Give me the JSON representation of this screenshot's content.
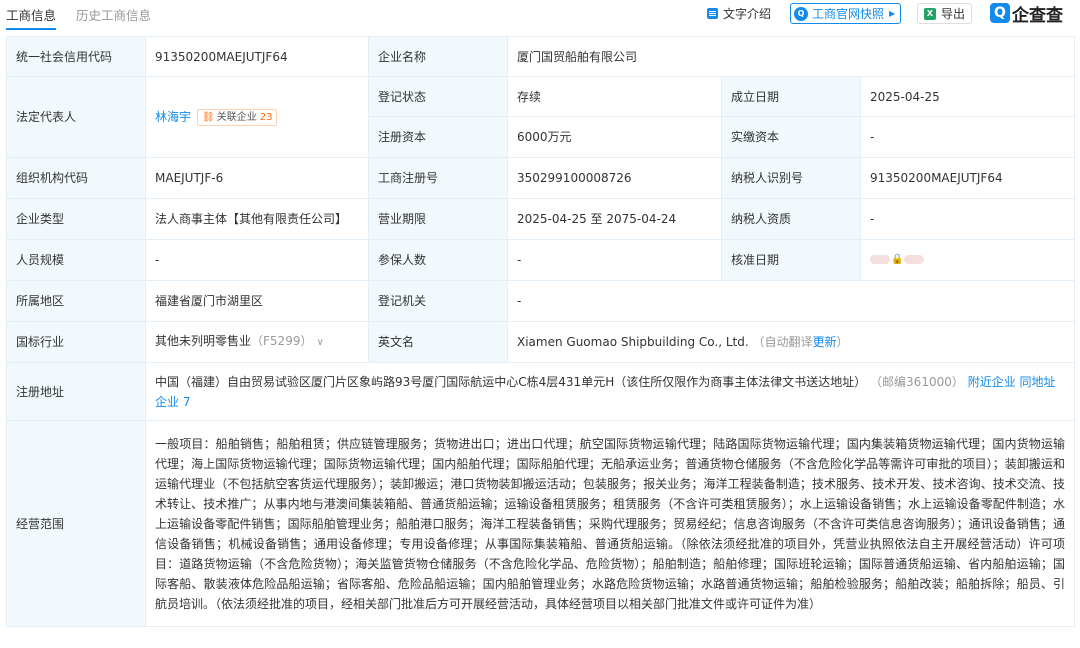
{
  "tabs": [
    {
      "label": "工商信息",
      "active": true
    },
    {
      "label": "历史工商信息",
      "active": false
    }
  ],
  "toolbar": {
    "intro_label": "文字介绍",
    "snapshot_label": "工商官网快照",
    "export_label": "导出",
    "brand_label": "企查查",
    "brand_mark": "Q",
    "excel_mark": "X"
  },
  "colors": {
    "accent": "#128bed",
    "label_bg": "#f2f9fc",
    "border": "#e4eef6",
    "related": "#ff6a00"
  },
  "labels": {
    "credit_code": "统一社会信用代码",
    "company_name": "企业名称",
    "legal_rep": "法定代表人",
    "reg_status": "登记状态",
    "est_date": "成立日期",
    "reg_capital": "注册资本",
    "paid_capital": "实缴资本",
    "org_code": "组织机构代码",
    "biz_reg_no": "工商注册号",
    "taxpayer_id": "纳税人识别号",
    "company_type": "企业类型",
    "biz_term": "营业期限",
    "taxpayer_qual": "纳税人资质",
    "staff_size": "人员规模",
    "insured": "参保人数",
    "approval_date": "核准日期",
    "region": "所属地区",
    "reg_authority": "登记机关",
    "industry": "国标行业",
    "english_name": "英文名",
    "reg_address": "注册地址",
    "biz_scope": "经营范围"
  },
  "values": {
    "credit_code": "91350200MAEJUTJF64",
    "company_name": "厦门国贸船舶有限公司",
    "legal_rep": "林海宇",
    "related_label": "关联企业",
    "related_count": "23",
    "reg_status": "存续",
    "est_date": "2025-04-25",
    "reg_capital": "6000万元",
    "paid_capital": "-",
    "org_code": "MAEJUTJF-6",
    "biz_reg_no": "350299100008726",
    "taxpayer_id": "91350200MAEJUTJF64",
    "company_type": "法人商事主体【其他有限责任公司】",
    "biz_term": "2025-04-25 至 2075-04-24",
    "taxpayer_qual": "-",
    "staff_size": "-",
    "insured": "-",
    "region": "福建省厦门市湖里区",
    "reg_authority": "-",
    "industry": "其他未列明零售业",
    "industry_code": "（F5299）",
    "english_name": "Xiamen Guomao Shipbuilding Co., Ltd.",
    "auto_translate": "（自动翻译",
    "update_label": "更新",
    "auto_translate_end": "）",
    "address": "中国（福建）自由贸易试验区厦门片区象屿路93号厦门国际航运中心C栋4层431单元H（该住所仅限作为商事主体法律文书送达地址）",
    "postcode": "（邮编361000）",
    "nearby": "附近企业",
    "same_address": "同地址企业 7",
    "scope": "一般项目：船舶销售；船舶租赁；供应链管理服务；货物进出口；进出口代理；航空国际货物运输代理；陆路国际货物运输代理；国内集装箱货物运输代理；国内货物运输代理；海上国际货物运输代理；国际货物运输代理；国内船舶代理；国际船舶代理；无船承运业务；普通货物仓储服务（不含危险化学品等需许可审批的项目）；装卸搬运和运输代理业（不包括航空客货运代理服务）；装卸搬运；港口货物装卸搬运活动；包装服务；报关业务；海洋工程装备制造；技术服务、技术开发、技术咨询、技术交流、技术转让、技术推广；从事内地与港澳间集装箱船、普通货船运输；运输设备租赁服务；租赁服务（不含许可类租赁服务）；水上运输设备销售；水上运输设备零配件制造；水上运输设备零配件销售；国际船舶管理业务；船舶港口服务；海洋工程装备销售；采购代理服务；贸易经纪；信息咨询服务（不含许可类信息咨询服务）；通讯设备销售；通信设备销售；机械设备销售；通用设备修理；专用设备修理；从事国际集装箱船、普通货船运输。（除依法须经批准的项目外，凭营业执照依法自主开展经营活动）许可项目：道路货物运输（不含危险货物）；海关监管货物仓储服务（不含危险化学品、危险货物）；船舶制造；船舶修理；国际班轮运输；国际普通货船运输、省内船舶运输；国际客船、散装液体危险品船运输；省际客船、危险品船运输；国内船舶管理业务；水路危险货物运输；水路普通货物运输；船舶检验服务；船舶改装；船舶拆除；船员、引航员培训。（依法须经批准的项目，经相关部门批准后方可开展经营活动，具体经营项目以相关部门批准文件或许可证件为准）"
  }
}
